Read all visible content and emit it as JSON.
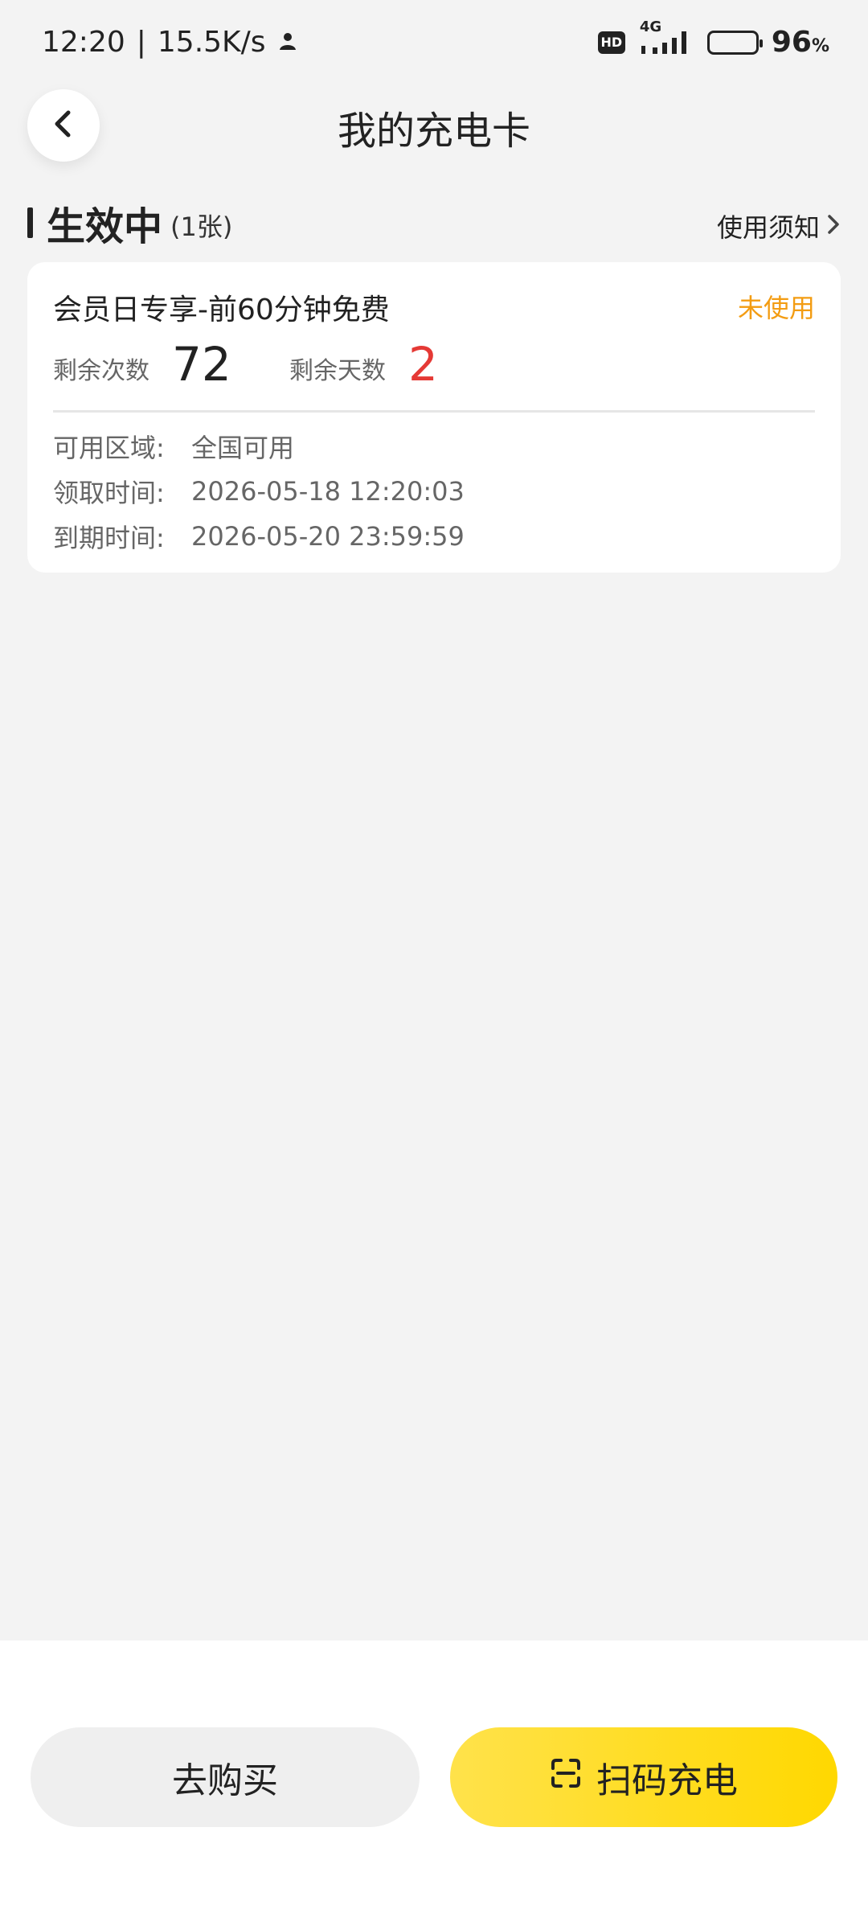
{
  "status_bar": {
    "time": "12:20",
    "separator": "|",
    "speed": "15.5K/s",
    "hd": "HD",
    "network": "4G",
    "battery": "96",
    "battery_unit": "%"
  },
  "header": {
    "title": "我的充电卡"
  },
  "section": {
    "title": "生效中",
    "count": "(1张)",
    "notice_label": "使用须知"
  },
  "card": {
    "title": "会员日专享-前60分钟免费",
    "status": "未使用",
    "remaining_times_label": "剩余次数",
    "remaining_times_value": "72",
    "remaining_days_label": "剩余天数",
    "remaining_days_value": "2",
    "details": [
      {
        "label": "可用区域:",
        "value": "全国可用"
      },
      {
        "label": "领取时间:",
        "value": "2026-05-18 12:20:03"
      },
      {
        "label": "到期时间:",
        "value": "2026-05-20 23:59:59"
      }
    ]
  },
  "actions": {
    "buy_label": "去购买",
    "scan_label": "扫码充电"
  },
  "colors": {
    "accent_yellow": "#ffd800",
    "status_orange": "#f39c12",
    "days_red": "#e53935"
  }
}
